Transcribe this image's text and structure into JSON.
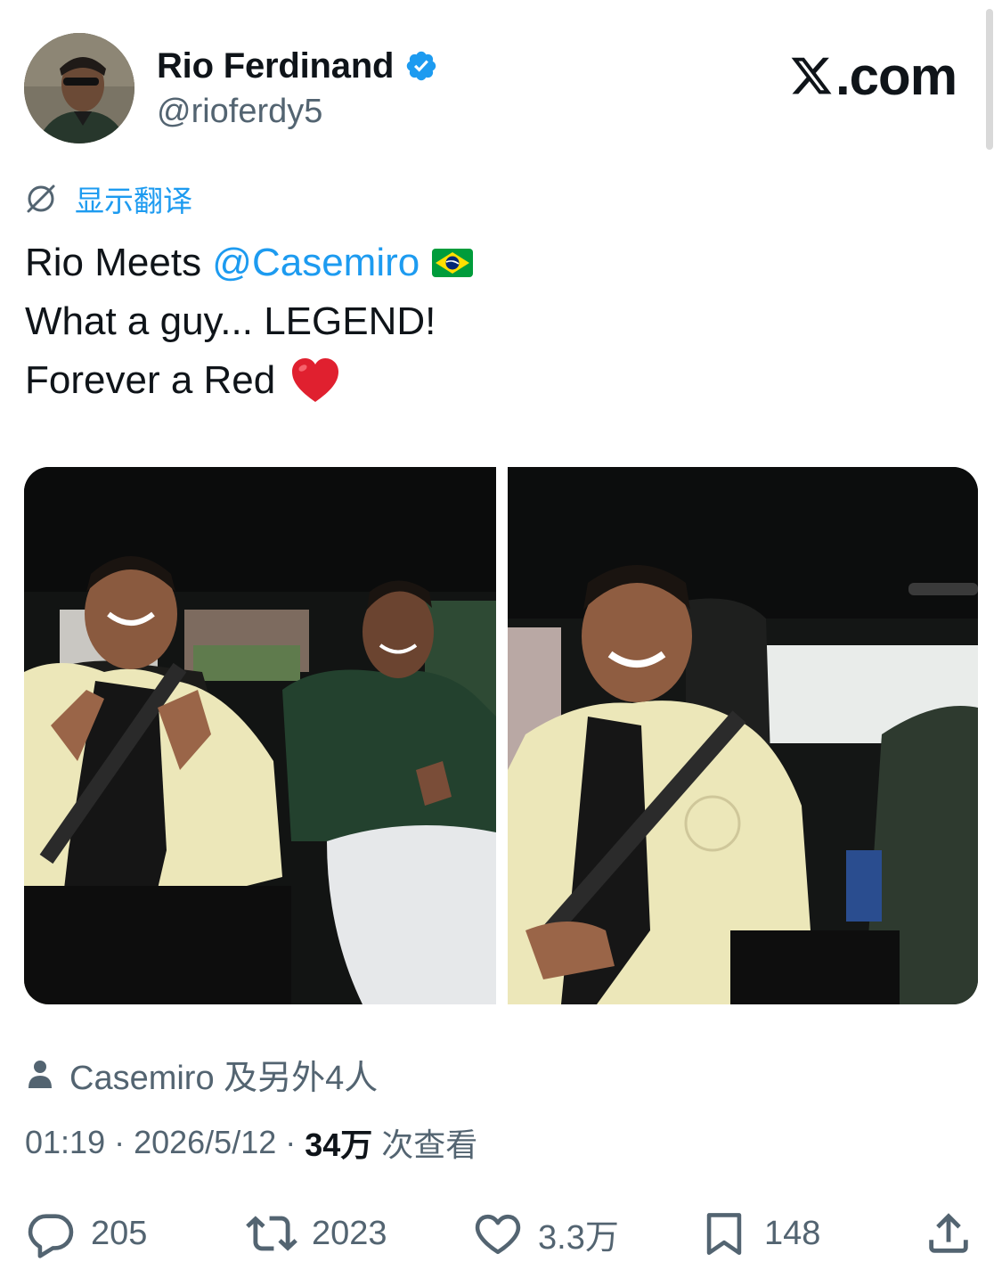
{
  "brand": {
    "site": "X.com",
    "accent": "#1d9bf0",
    "text_primary": "#0f1419",
    "text_secondary": "#536471"
  },
  "author": {
    "display_name": "Rio Ferdinand",
    "handle": "@rioferdy5",
    "verified": true,
    "avatar_icon": "profile-photo"
  },
  "translate": {
    "label": "显示翻译",
    "icon": "translate-globe-icon"
  },
  "tweet": {
    "line1_prefix": "Rio Meets ",
    "mention": "@Casemiro",
    "line1_emoji": "brazil-flag",
    "line2": "What a guy... LEGEND!",
    "line3": "Forever a Red",
    "line3_emoji": "red-heart"
  },
  "media": [
    {
      "name": "photo-casemiro-and-rio-in-car"
    },
    {
      "name": "photo-casemiro-smiling-in-car"
    }
  ],
  "tagged": {
    "icon": "person-icon",
    "text": "Casemiro 及另外4人"
  },
  "meta": {
    "time": "01:19",
    "separator": " · ",
    "date": "2026/5/12",
    "views_count": "34万",
    "views_label": " 次查看"
  },
  "actions": {
    "reply": {
      "icon": "reply-icon",
      "count": "205"
    },
    "retweet": {
      "icon": "retweet-icon",
      "count": "2023"
    },
    "like": {
      "icon": "heart-icon",
      "count": "3.3万"
    },
    "bookmark": {
      "icon": "bookmark-icon",
      "count": "148"
    },
    "share": {
      "icon": "share-icon"
    }
  }
}
